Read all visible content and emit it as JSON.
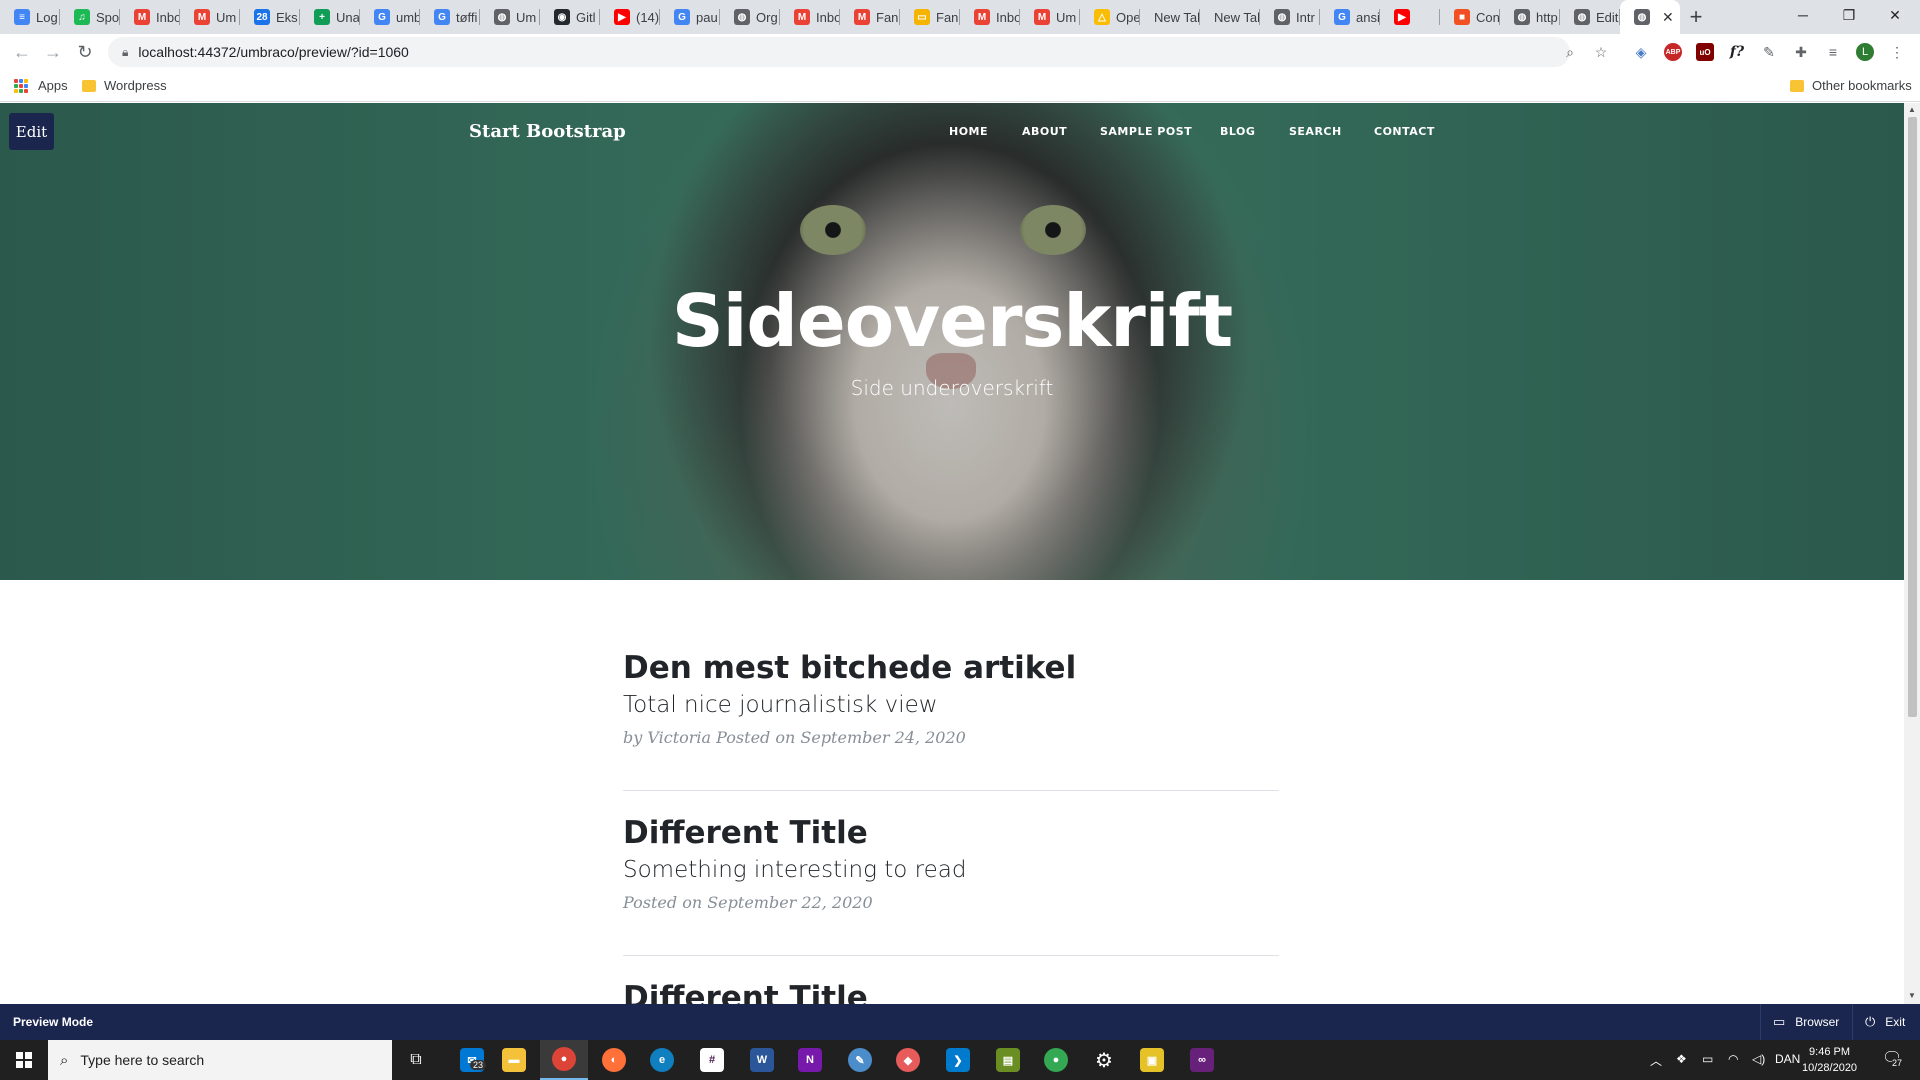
{
  "browser": {
    "tabs": [
      {
        "label": "Log",
        "icon": "docs-icon",
        "color": "#4285f4",
        "glyph": "≡"
      },
      {
        "label": "Spo",
        "icon": "spotify-icon",
        "color": "#1db954",
        "glyph": "♫"
      },
      {
        "label": "Inbo",
        "icon": "gmail-icon",
        "color": "#ea4335",
        "glyph": "M"
      },
      {
        "label": "Um",
        "icon": "gmail-icon",
        "color": "#ea4335",
        "glyph": "M"
      },
      {
        "label": "Eks",
        "icon": "calendar-icon",
        "color": "#1a73e8",
        "glyph": "28"
      },
      {
        "label": "Una",
        "icon": "sheets-icon",
        "color": "#0f9d58",
        "glyph": "+"
      },
      {
        "label": "umb",
        "icon": "google-icon",
        "color": "#4285f4",
        "glyph": "G"
      },
      {
        "label": "tøffi",
        "icon": "google-icon",
        "color": "#4285f4",
        "glyph": "G"
      },
      {
        "label": "Um",
        "icon": "globe-icon",
        "color": "#5f6368",
        "glyph": "◍"
      },
      {
        "label": "Gitl",
        "icon": "github-icon",
        "color": "#24292e",
        "glyph": "◉"
      },
      {
        "label": "(14)",
        "icon": "youtube-icon",
        "color": "#ff0000",
        "glyph": "▶"
      },
      {
        "label": "pau",
        "icon": "google-icon",
        "color": "#4285f4",
        "glyph": "G"
      },
      {
        "label": "Org",
        "icon": "globe-icon",
        "color": "#5f6368",
        "glyph": "◍"
      },
      {
        "label": "Inbo",
        "icon": "gmail-icon",
        "color": "#ea4335",
        "glyph": "M"
      },
      {
        "label": "Fan",
        "icon": "gmail-icon",
        "color": "#ea4335",
        "glyph": "M"
      },
      {
        "label": "Fan",
        "icon": "slides-icon",
        "color": "#f4b400",
        "glyph": "▭"
      },
      {
        "label": "Inbo",
        "icon": "gmail-icon",
        "color": "#ea4335",
        "glyph": "M"
      },
      {
        "label": "Um",
        "icon": "gmail-icon",
        "color": "#ea4335",
        "glyph": "M"
      },
      {
        "label": "Ope",
        "icon": "drive-icon",
        "color": "#fbbc04",
        "glyph": "△"
      },
      {
        "label": "New Tab",
        "icon": "",
        "color": "",
        "glyph": ""
      },
      {
        "label": "New Tab",
        "icon": "",
        "color": "",
        "glyph": ""
      },
      {
        "label": "Intr",
        "icon": "globe-icon",
        "color": "#5f6368",
        "glyph": "◍"
      },
      {
        "label": "ansi",
        "icon": "google-icon",
        "color": "#4285f4",
        "glyph": "G"
      },
      {
        "label": "",
        "icon": "youtube-icon",
        "color": "#ff0000",
        "glyph": "▶"
      },
      {
        "label": "Con",
        "icon": "microsoft-icon",
        "color": "#f25022",
        "glyph": "■"
      },
      {
        "label": "http",
        "icon": "globe-icon",
        "color": "#5f6368",
        "glyph": "◍"
      },
      {
        "label": "Edit",
        "icon": "globe-icon",
        "color": "#5f6368",
        "glyph": "◍"
      }
    ],
    "active_tab_label": "",
    "url": "localhost:44372/umbraco/preview/?id=1060",
    "profile_initial": "L",
    "bookmarks": {
      "apps": "Apps",
      "wordpress": "Wordpress",
      "other": "Other bookmarks"
    },
    "extensions": [
      "ABP",
      "uO",
      "f?"
    ]
  },
  "site": {
    "edit_label": "Edit",
    "brand": "Start Bootstrap",
    "nav": [
      "HOME",
      "ABOUT",
      "SAMPLE POST",
      "BLOG",
      "SEARCH",
      "CONTACT"
    ],
    "hero_title": "Sideoverskrift",
    "hero_subtitle": "Side underoverskrift",
    "posts": [
      {
        "title": "Den mest bitchede artikel",
        "subtitle": "Total nice journalistisk view",
        "meta": "by Victoria Posted on September 24, 2020"
      },
      {
        "title": "Different Title",
        "subtitle": "Something interesting to read",
        "meta": "Posted on September 22, 2020"
      },
      {
        "title": "Different Title",
        "subtitle": "",
        "meta": ""
      }
    ]
  },
  "preview_bar": {
    "label": "Preview Mode",
    "browser_label": "Browser",
    "exit_label": "Exit"
  },
  "taskbar": {
    "search_placeholder": "Type here to search",
    "mail_badge": "23",
    "language": "DAN",
    "time": "9:46 PM",
    "date": "10/28/2020",
    "notification_count": "27"
  }
}
